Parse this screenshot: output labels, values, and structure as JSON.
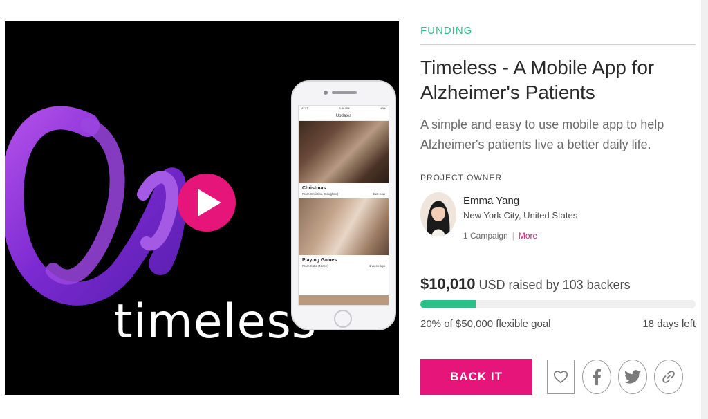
{
  "media": {
    "wordmark": "timeless",
    "play_icon": "play-icon",
    "phone": {
      "app_title": "Updates",
      "status_left": "AT&T",
      "status_time": "5:30 PM",
      "status_right": "49%",
      "card1_title": "Christmas",
      "card1_sub": "From Christina (Daughter)",
      "card1_time": "Just now",
      "card2_title": "Playing Games",
      "card2_sub": "From Katie (Niece)",
      "card2_time": "1 week ago"
    }
  },
  "project": {
    "category": "FUNDING",
    "title": "Timeless - A Mobile App for Alzheimer's Patients",
    "blurb": "A simple and easy to use mobile app to help Alzheimer's patients live a better daily life."
  },
  "owner": {
    "label": "PROJECT OWNER",
    "name": "Emma Yang",
    "location": "New York City, United States",
    "campaigns": "1 Campaign",
    "separator": "|",
    "more": "More"
  },
  "funding": {
    "amount": "$10,010",
    "raised_text": "USD raised by 103 backers",
    "percent_fraction": 0.2,
    "percent_text": "20%",
    "goal_text": "of $50,000",
    "goal_link": "flexible goal",
    "days_number": "18",
    "days_text": "days left"
  },
  "actions": {
    "back_label": "BACK IT",
    "follow_icon": "heart-icon",
    "facebook_icon": "facebook-icon",
    "twitter_icon": "twitter-icon",
    "link_icon": "link-icon"
  },
  "colors": {
    "accent": "#e5157a",
    "category_green": "#2bbf8a",
    "media_bg": "#000000",
    "logo_purple": "#8a35d6"
  }
}
